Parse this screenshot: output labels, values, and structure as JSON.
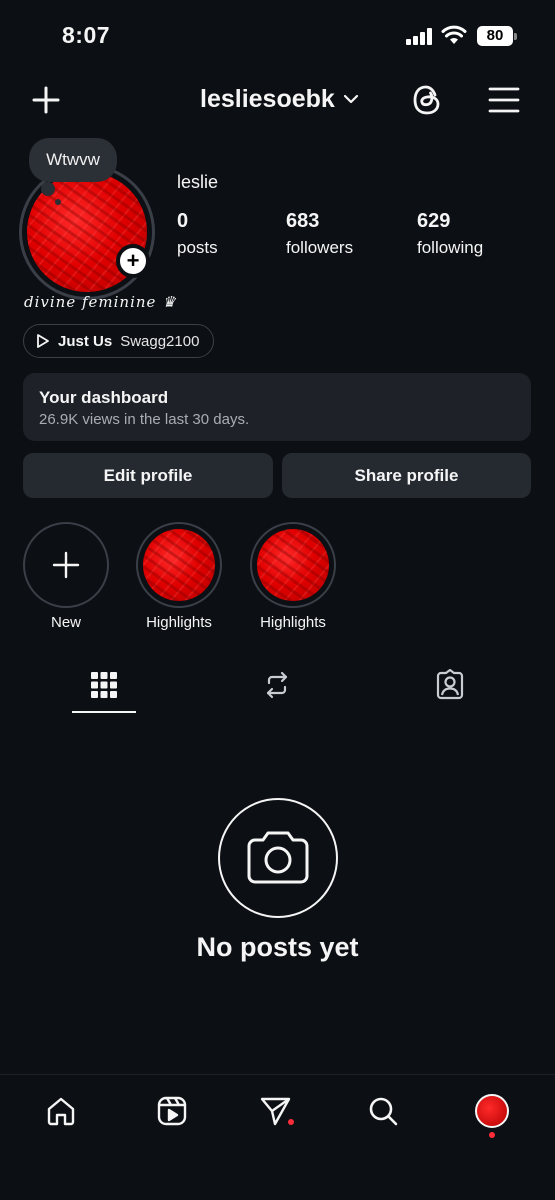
{
  "status": {
    "time": "8:07",
    "battery": "80"
  },
  "header": {
    "username": "lesliesoebk"
  },
  "note": {
    "text": "Wtwvw"
  },
  "profile": {
    "display_name": "leslie",
    "stats": [
      {
        "value": "0",
        "label": "posts"
      },
      {
        "value": "683",
        "label": "followers"
      },
      {
        "value": "629",
        "label": "following"
      }
    ],
    "bio": "divine feminine ♛",
    "music": {
      "song": "Just Us",
      "artist": "Swagg2100"
    }
  },
  "dashboard": {
    "title": "Your dashboard",
    "subtitle": "26.9K views in the last 30 days."
  },
  "buttons": {
    "edit": "Edit profile",
    "share": "Share profile"
  },
  "highlights": [
    {
      "label": "New"
    },
    {
      "label": "Highlights"
    },
    {
      "label": "Highlights"
    }
  ],
  "tabs": [
    "grid-icon",
    "reposts-icon",
    "tagged-icon"
  ],
  "empty_state": {
    "text": "No posts yet"
  },
  "bottom_nav": [
    "home-icon",
    "reels-icon",
    "direct-icon",
    "search-icon",
    "profile-avatar"
  ],
  "colors": {
    "background": "#0c0f14",
    "card": "#1e2228",
    "button": "#252a31",
    "accent_red": "#e00000",
    "notification_dot": "#ff2d3a"
  }
}
